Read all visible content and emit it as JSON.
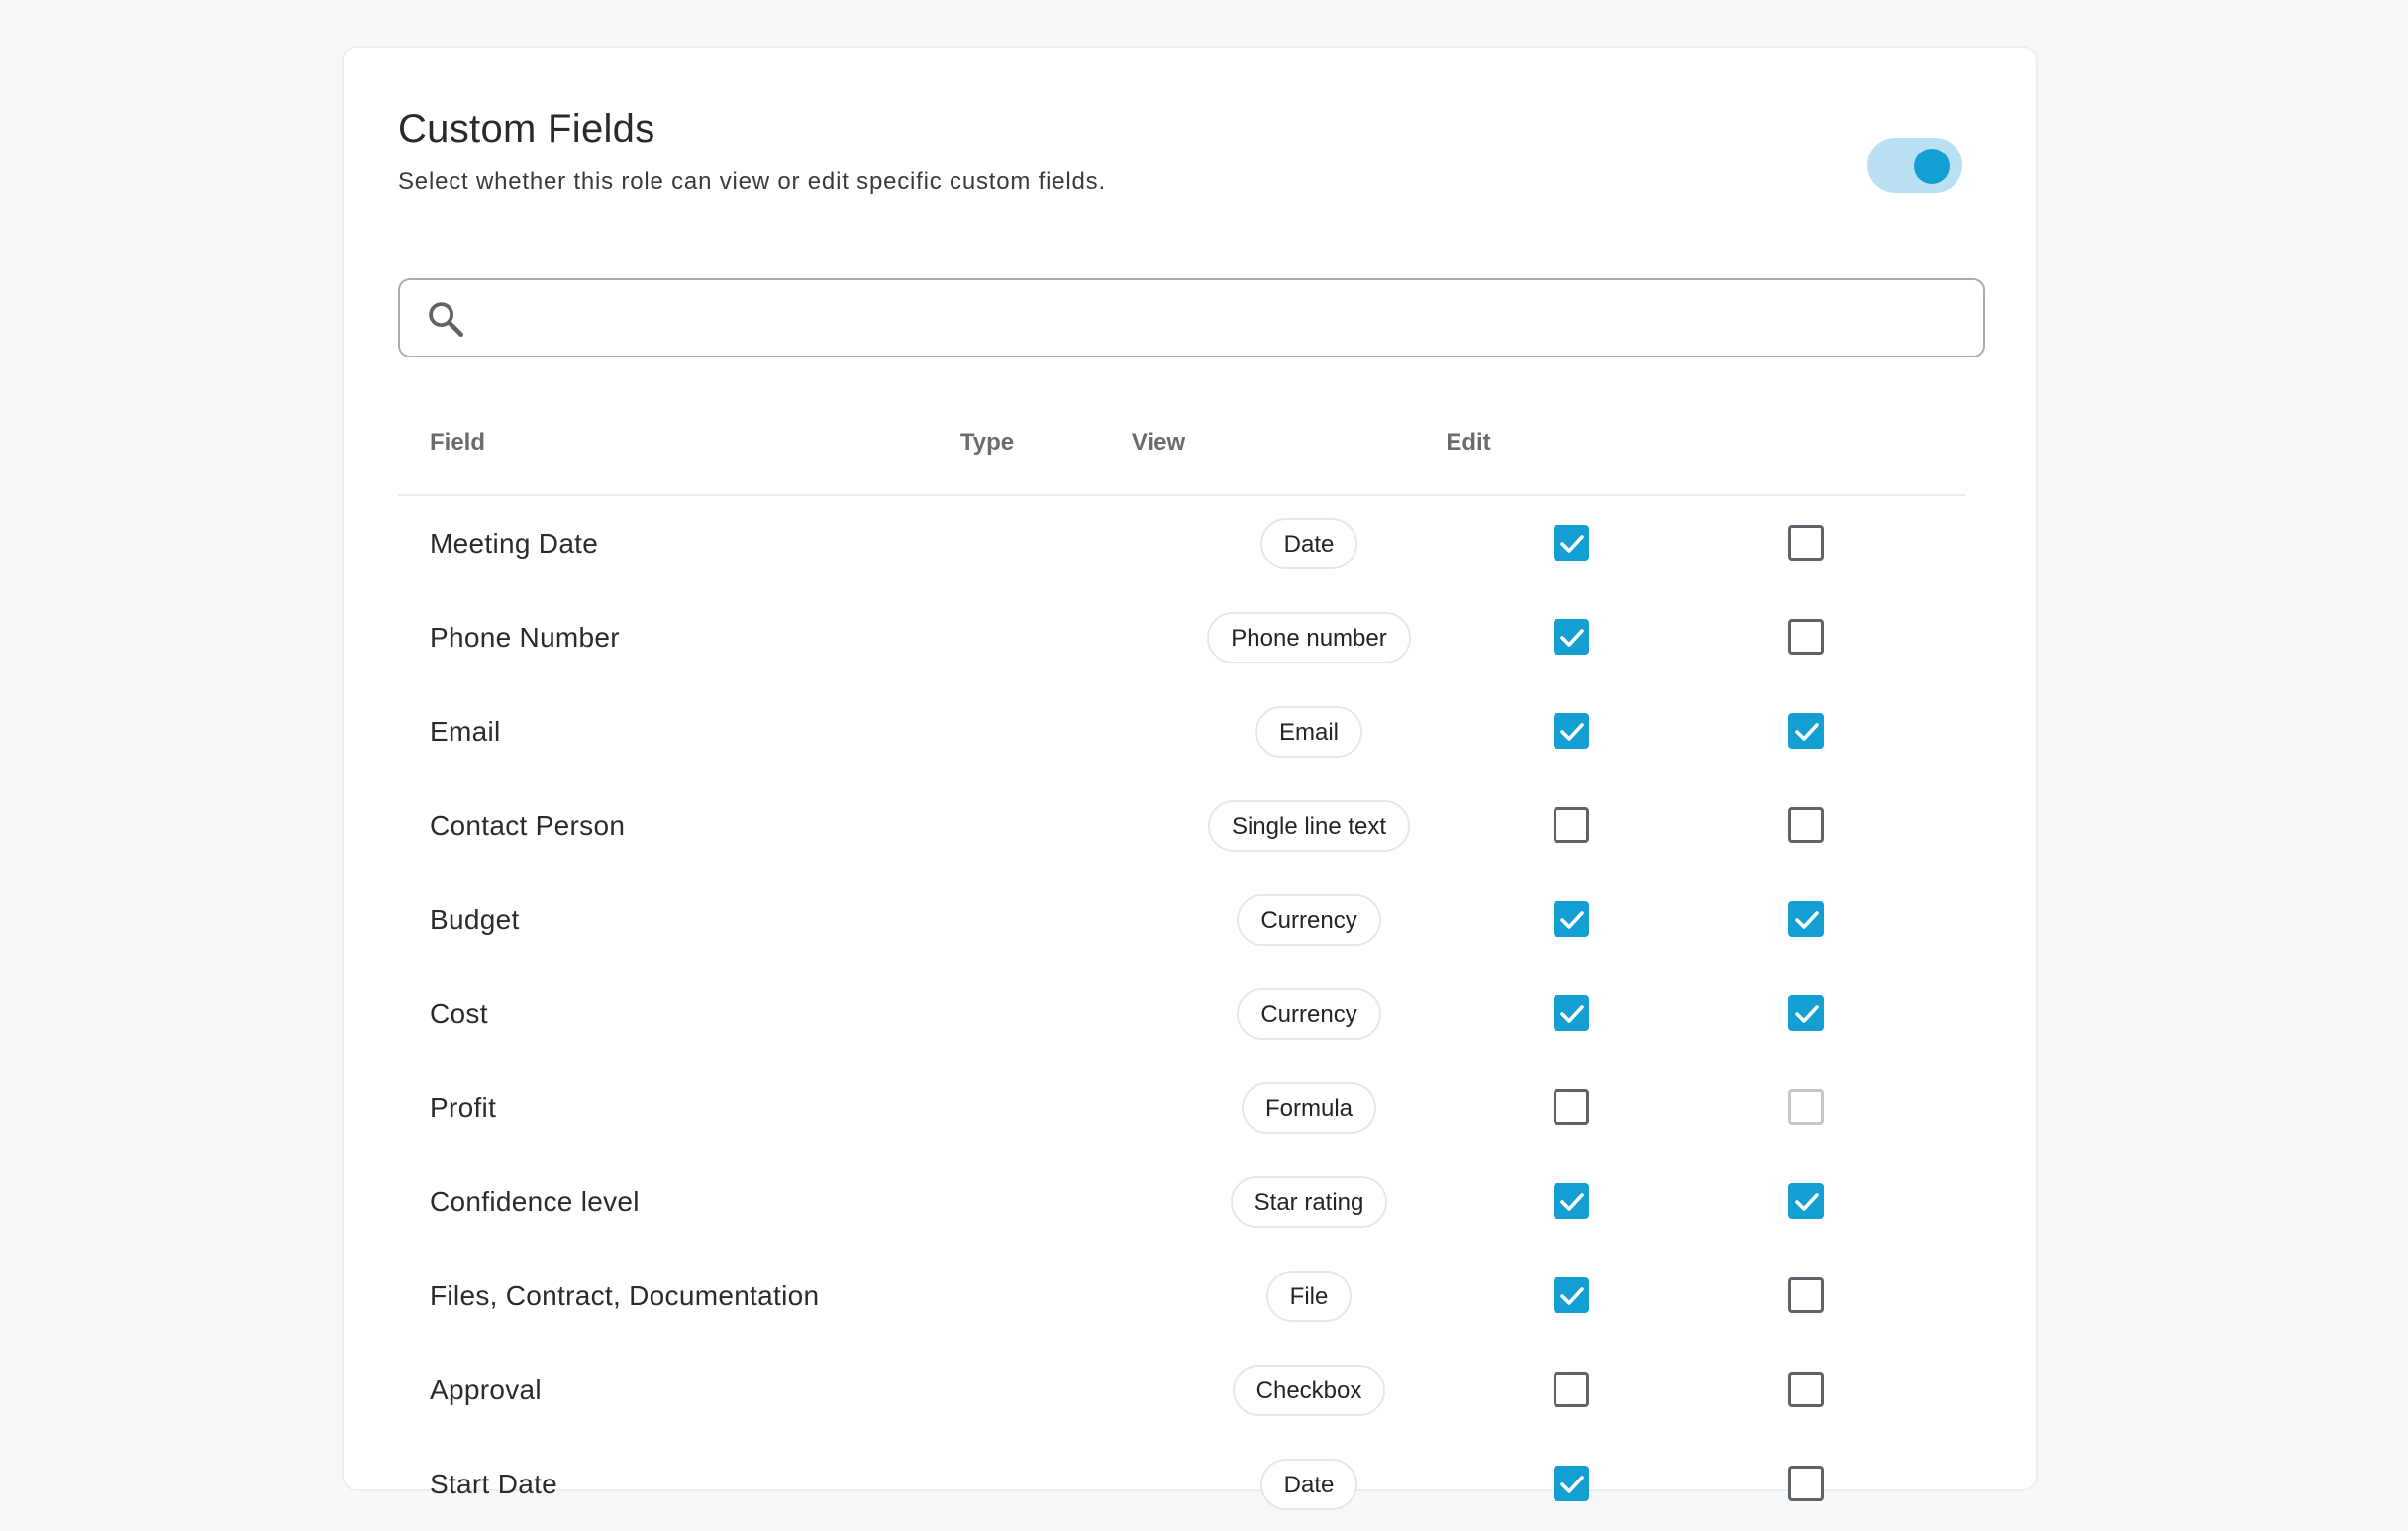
{
  "section": {
    "title": "Custom Fields",
    "subtitle": "Select whether this role can view or edit specific custom fields.",
    "enabled": true
  },
  "search": {
    "placeholder": "",
    "value": ""
  },
  "table": {
    "columns": {
      "field": "Field",
      "type": "Type",
      "view": "View",
      "edit": "Edit"
    },
    "rows": [
      {
        "name": "Meeting Date",
        "type": "Date",
        "view": "on",
        "edit": "off"
      },
      {
        "name": "Phone Number",
        "type": "Phone number",
        "view": "on",
        "edit": "off"
      },
      {
        "name": "Email",
        "type": "Email",
        "view": "on",
        "edit": "on"
      },
      {
        "name": "Contact Person",
        "type": "Single line text",
        "view": "off",
        "edit": "off"
      },
      {
        "name": "Budget",
        "type": "Currency",
        "view": "on",
        "edit": "on"
      },
      {
        "name": "Cost",
        "type": "Currency",
        "view": "on",
        "edit": "on"
      },
      {
        "name": "Profit",
        "type": "Formula",
        "view": "off",
        "edit": "disabled"
      },
      {
        "name": "Confidence level",
        "type": "Star rating",
        "view": "on",
        "edit": "on"
      },
      {
        "name": "Files, Contract, Documentation",
        "type": "File",
        "view": "on",
        "edit": "off"
      },
      {
        "name": "Approval",
        "type": "Checkbox",
        "view": "off",
        "edit": "off"
      },
      {
        "name": "Start Date",
        "type": "Date",
        "view": "on",
        "edit": "off"
      }
    ]
  },
  "colors": {
    "accent": "#149fd2",
    "toggle_track": "#b9e0f0"
  }
}
